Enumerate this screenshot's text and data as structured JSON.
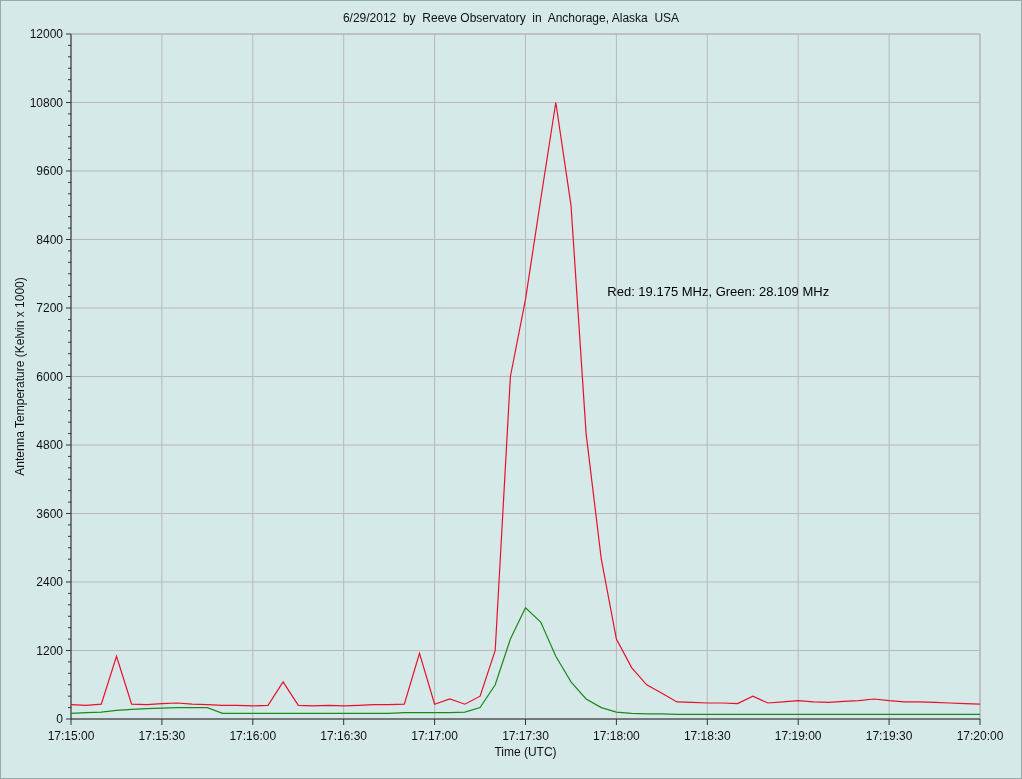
{
  "chart": {
    "chart_data": {
      "type": "line",
      "title": "6/29/2012  by  Reeve Observatory  in  Anchorage, Alaska  USA",
      "grid": true,
      "xlabel": "Time (UTC)",
      "ylabel": "Antenna Temperature (Kelvin x 1000)",
      "categories": [
        "17:15:00",
        null,
        null,
        null,
        null,
        null,
        "17:15:30",
        null,
        null,
        null,
        null,
        null,
        "17:16:00",
        null,
        null,
        null,
        null,
        null,
        "17:16:30",
        null,
        null,
        null,
        null,
        null,
        "17:17:00",
        null,
        null,
        null,
        null,
        null,
        "17:17:30",
        null,
        null,
        null,
        null,
        null,
        "17:18:00",
        null,
        null,
        null,
        null,
        null,
        "17:18:30",
        null,
        null,
        null,
        null,
        null,
        "17:19:00",
        null,
        null,
        null,
        null,
        null,
        "17:19:30",
        null,
        null,
        null,
        null,
        null,
        "17:20:00"
      ],
      "series": [
        {
          "color": "#e8102a",
          "values": [
            250,
            240,
            260,
            1100,
            260,
            250,
            270,
            280,
            260,
            250,
            240,
            240,
            230,
            240,
            650,
            240,
            230,
            240,
            230,
            240,
            250,
            250,
            260,
            1150,
            260,
            350,
            260,
            400,
            1200,
            6000,
            7350,
            9100,
            10800,
            9000,
            5000,
            2800,
            1400,
            900,
            600,
            450,
            300,
            290,
            280,
            280,
            270,
            400,
            280,
            300,
            320,
            300,
            290,
            310,
            320,
            350,
            320,
            300,
            300,
            290,
            280,
            270,
            260
          ]
        },
        {
          "color": "#1a8a1a",
          "values": [
            100,
            110,
            120,
            150,
            170,
            180,
            190,
            200,
            200,
            200,
            100,
            100,
            100,
            100,
            100,
            100,
            100,
            100,
            100,
            100,
            100,
            100,
            110,
            110,
            110,
            110,
            120,
            200,
            600,
            1400,
            1950,
            1700,
            1100,
            650,
            350,
            200,
            120,
            100,
            90,
            90,
            80,
            80,
            80,
            80,
            80,
            80,
            80,
            80,
            80,
            80,
            80,
            80,
            80,
            80,
            80,
            80,
            80,
            80,
            80,
            80,
            80
          ]
        }
      ],
      "ylim": [
        0,
        12000
      ],
      "yticks": [
        0,
        1200,
        2400,
        3600,
        4800,
        6000,
        7200,
        8400,
        9600,
        10800,
        12000
      ],
      "annotations": [
        "Red: 19.175 MHz, Green: 28.109 MHz"
      ]
    }
  }
}
